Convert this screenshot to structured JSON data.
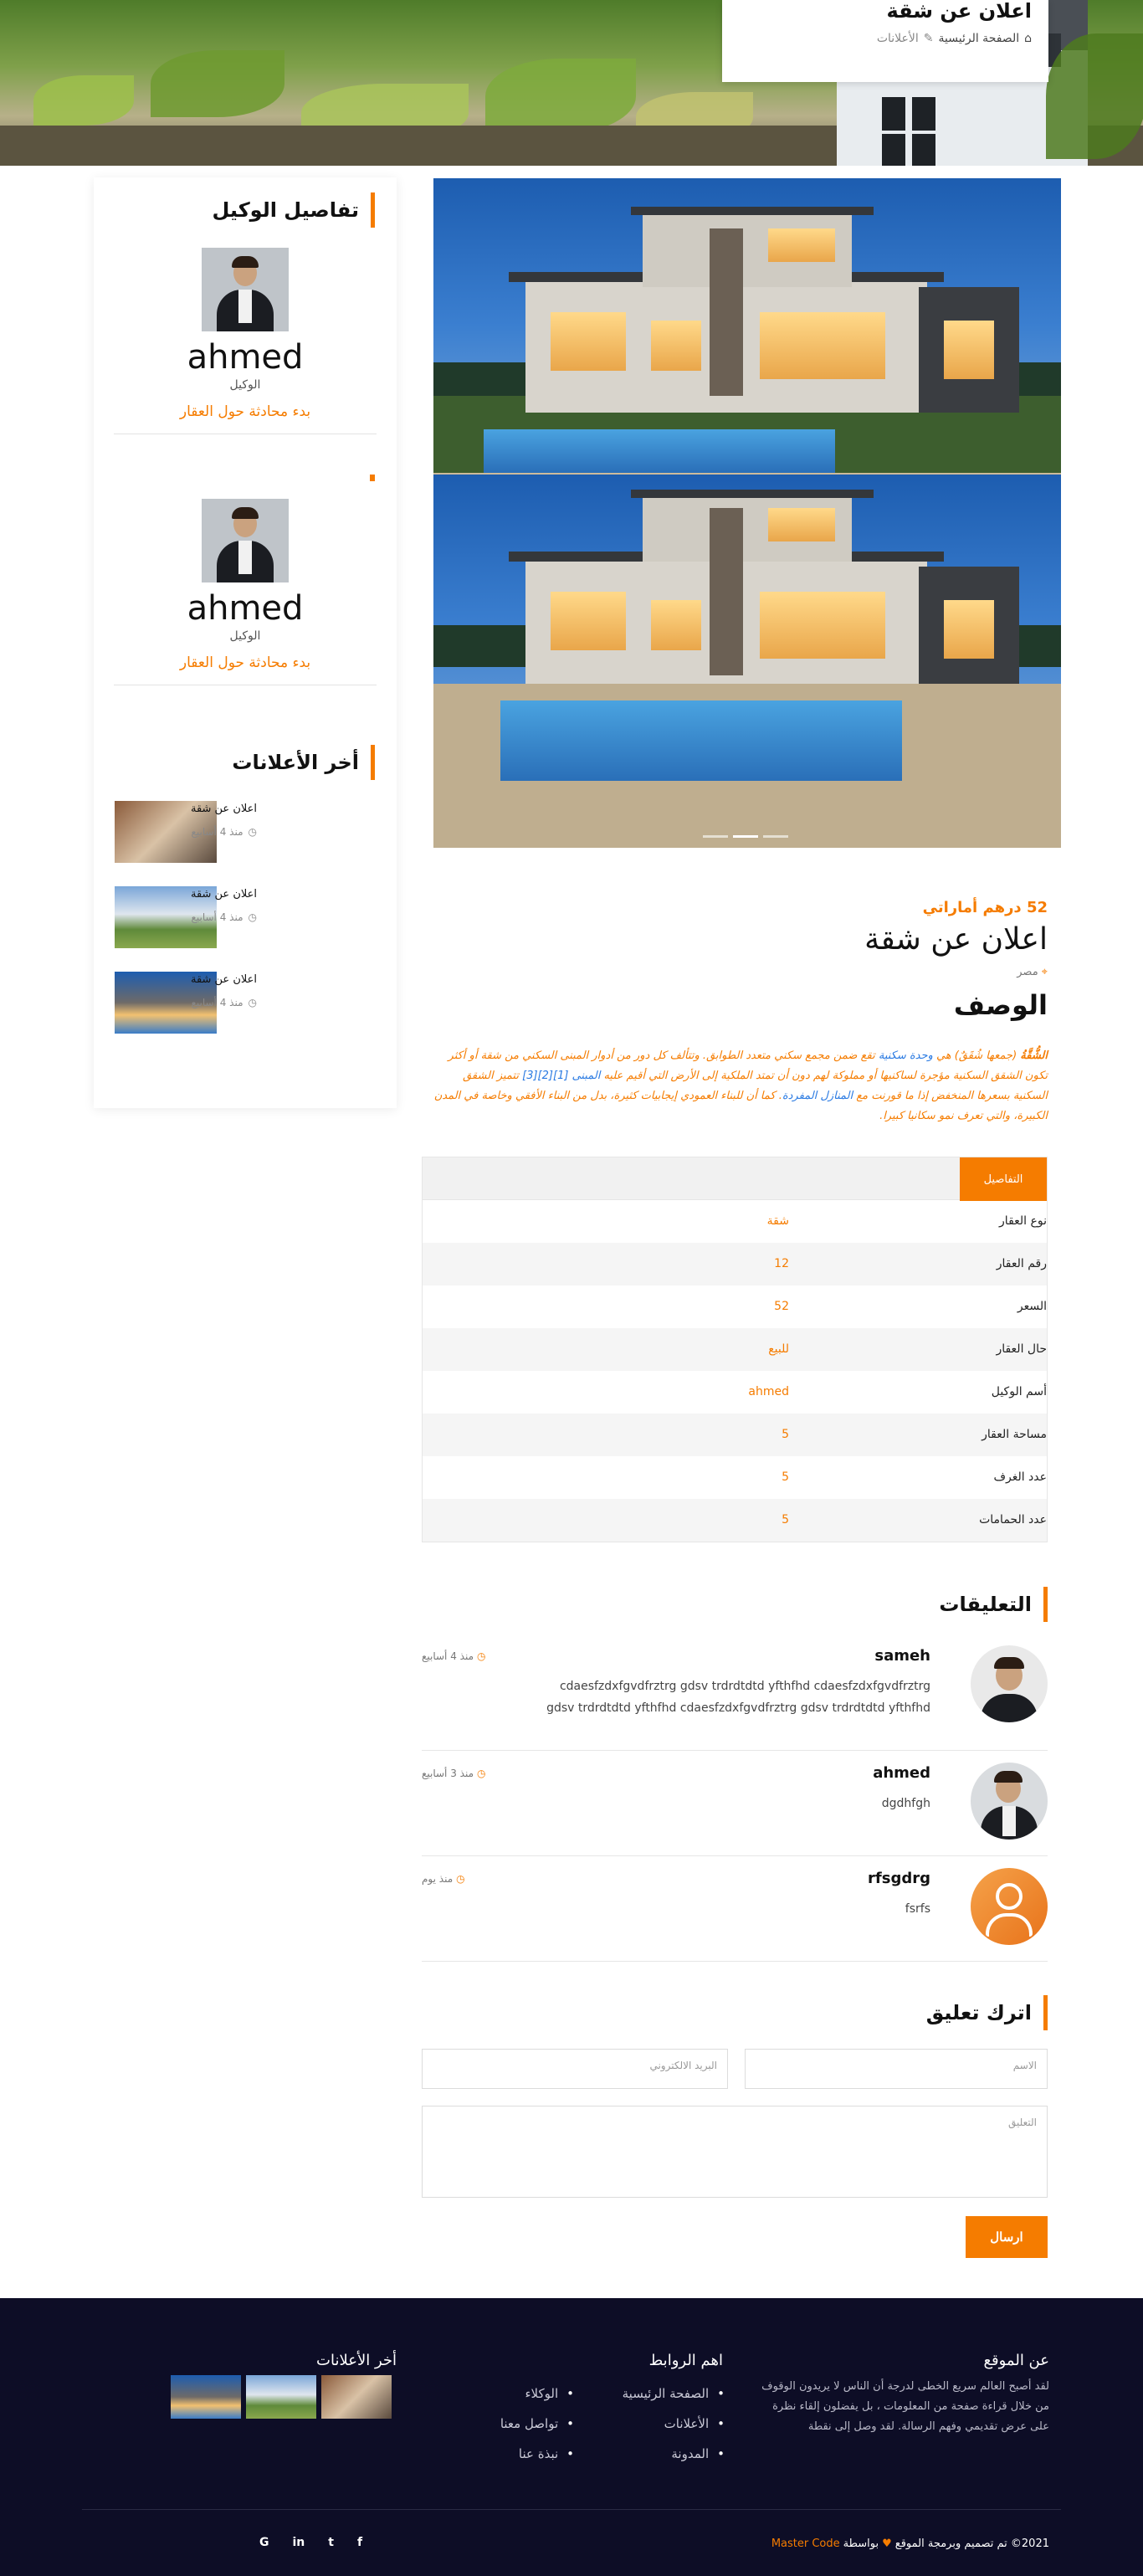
{
  "hero": {
    "title": "اعلان عن شقة",
    "breadcrumb_home": "الصفحة الرئيسية",
    "breadcrumb_current": "الأعلانات"
  },
  "sidebar": {
    "agent_section_title": "تفاصيل الوكيل",
    "agents": [
      {
        "name": "ahmed",
        "role": "الوكيل",
        "chat_label": "بدء محادثة حول العقار"
      },
      {
        "name": "ahmed",
        "role": "الوكيل",
        "chat_label": "بدء محادثة حول العقار"
      }
    ],
    "recent_title": "أخر الأعلانات",
    "recent": [
      {
        "title": "اعلان عن شقة",
        "time": "منذ 4 أسابيع"
      },
      {
        "title": "اعلان عن شقة",
        "time": "منذ 4 أسابيع"
      },
      {
        "title": "اعلان عن شقة",
        "time": "منذ 4 أسابيع"
      }
    ]
  },
  "listing": {
    "price": "52 درهم أماراتي",
    "title": "اعلان عن شقة",
    "location": "مصر",
    "description_heading": "الوصف",
    "description": {
      "p1_bold": "الشُّقَّةُ",
      "p1": " (جمعها شُقَقٌ) هي",
      "p1_link": " وحدة سكنية",
      "p2": " تقع ضمن مجمع سكني متعدد الطوابق. وتتألف كل دور من أدوار المبنى السكني من شقة أو أكثر",
      "p2_i": " تكون الشقق السكنية مؤجرة لساكنيها",
      "p3": " أو مملوكة لهم دون أن تمتد الملكية إلى الأرض التي أقيم عليه",
      "p3_link": " المبنى [1][2][3]",
      "p4": " تتميز الشقق السكنية بسعرها المنخفض إذا ما قورنت مع",
      "p4_link": " المنازل المفردة",
      "p5": ". كما أن للبناء العمودي إيجابيات كثيرة، بدل من البناء الأفقي وخاصة في المدن الكبيرة، والتي تعرف نمو سكانيا كبيرا."
    }
  },
  "details": {
    "tab_label": "التفاصيل",
    "rows": [
      {
        "key": "نوع العقار",
        "value": "شقة"
      },
      {
        "key": "رقم العقار",
        "value": "12"
      },
      {
        "key": "السعر",
        "value": "52"
      },
      {
        "key": "حال العقار",
        "value": "للبيع"
      },
      {
        "key": "أسم الوكيل",
        "value": "ahmed"
      },
      {
        "key": "مساحة العقار",
        "value": "5"
      },
      {
        "key": "عدد الغرف",
        "value": "5"
      },
      {
        "key": "عدد الحمامات",
        "value": "5"
      }
    ]
  },
  "comments": {
    "title": "التعليقات",
    "items": [
      {
        "name": "sameh",
        "text": "cdaesfzdxfgvdfrztrg gdsv trdrdtdtd yfthfhd cdaesfzdxfgvdfrztrg gdsv trdrdtdtd yfthfhd cdaesfzdxfgvdfrztrg gdsv trdrdtdtd yfthfhd",
        "time": "منذ 4 أسابيع"
      },
      {
        "name": "ahmed",
        "text": "dgdhfgh",
        "time": "منذ 3 أسابيع"
      },
      {
        "name": "rfsgdrg",
        "text": "fsrfs",
        "time": "منذ يوم"
      }
    ]
  },
  "comment_form": {
    "title": "اترك تعليق",
    "name_placeholder": "الاسم",
    "email_placeholder": "البريد الالكتروني",
    "comment_placeholder": "التعليق",
    "submit_label": "ارسال"
  },
  "footer": {
    "about_title": "عن الموقع",
    "about_text": "لقد أصبح العالم سريع الخطى لدرجة أن الناس لا يريدون الوقوف من خلال قراءة صفحة من المعلومات ، بل يفضلون إلقاء نظرة على عرض تقديمي وفهم الرسالة. لقد وصل إلى نقطة",
    "links_title": "اهم الروابط",
    "links_col1": [
      "الصفحة الرئيسية",
      "الأعلانات",
      "المدونة"
    ],
    "links_col2": [
      "الوكلاء",
      "تواصل معنا",
      "نبذة عنا"
    ],
    "recent_title": "أخر الأعلانات",
    "copyright": "2021© تم تصميم وبرمجة الموقع",
    "by": "بواسطة",
    "brand": "Master Code",
    "social": [
      "f",
      "t",
      "in",
      "G"
    ]
  },
  "colors": {
    "accent": "#f57c00",
    "footer_bg": "#0d0d26",
    "link": "#2a7ae2"
  }
}
